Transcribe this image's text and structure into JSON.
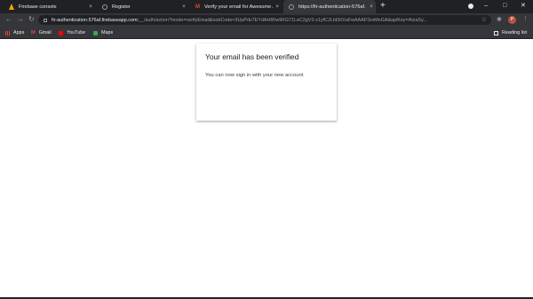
{
  "browser": {
    "tabs": [
      {
        "title": "Firebase console",
        "icon": "firebase-icon",
        "active": false
      },
      {
        "title": "Register",
        "icon": "globe-icon",
        "active": false
      },
      {
        "title": "Verify your email for Awesome A",
        "icon": "gmail-icon",
        "active": false
      },
      {
        "title": "https://fir-authentication-576af.",
        "icon": "globe-icon",
        "active": true
      }
    ],
    "new_tab": "+",
    "close_glyph": "×",
    "url_host": "fir-authentication-576af.firebaseapp.com",
    "url_path": "/__/auth/action?mode=verifyEmail&oobCode=3UpPdv7EYdAH80w9KG71LeC2gV2-z1yfCJLId3rlXaFwAAAFSrvMnGA&apiKey=AIzaSy...",
    "profile_initial": "P",
    "bookmarks": [
      {
        "label": "Apps",
        "icon": "apps-icon"
      },
      {
        "label": "Gmail",
        "icon": "gmail-icon"
      },
      {
        "label": "YouTube",
        "icon": "youtube-icon"
      },
      {
        "label": "Maps",
        "icon": "maps-icon"
      }
    ],
    "reading_list": "Reading list"
  },
  "card": {
    "title": "Your email has been verified",
    "message": "You can now sign in with your new account"
  },
  "colors": {
    "tab_strip": "#202124",
    "toolbar": "#35363a",
    "page_background": "#ffffff"
  }
}
